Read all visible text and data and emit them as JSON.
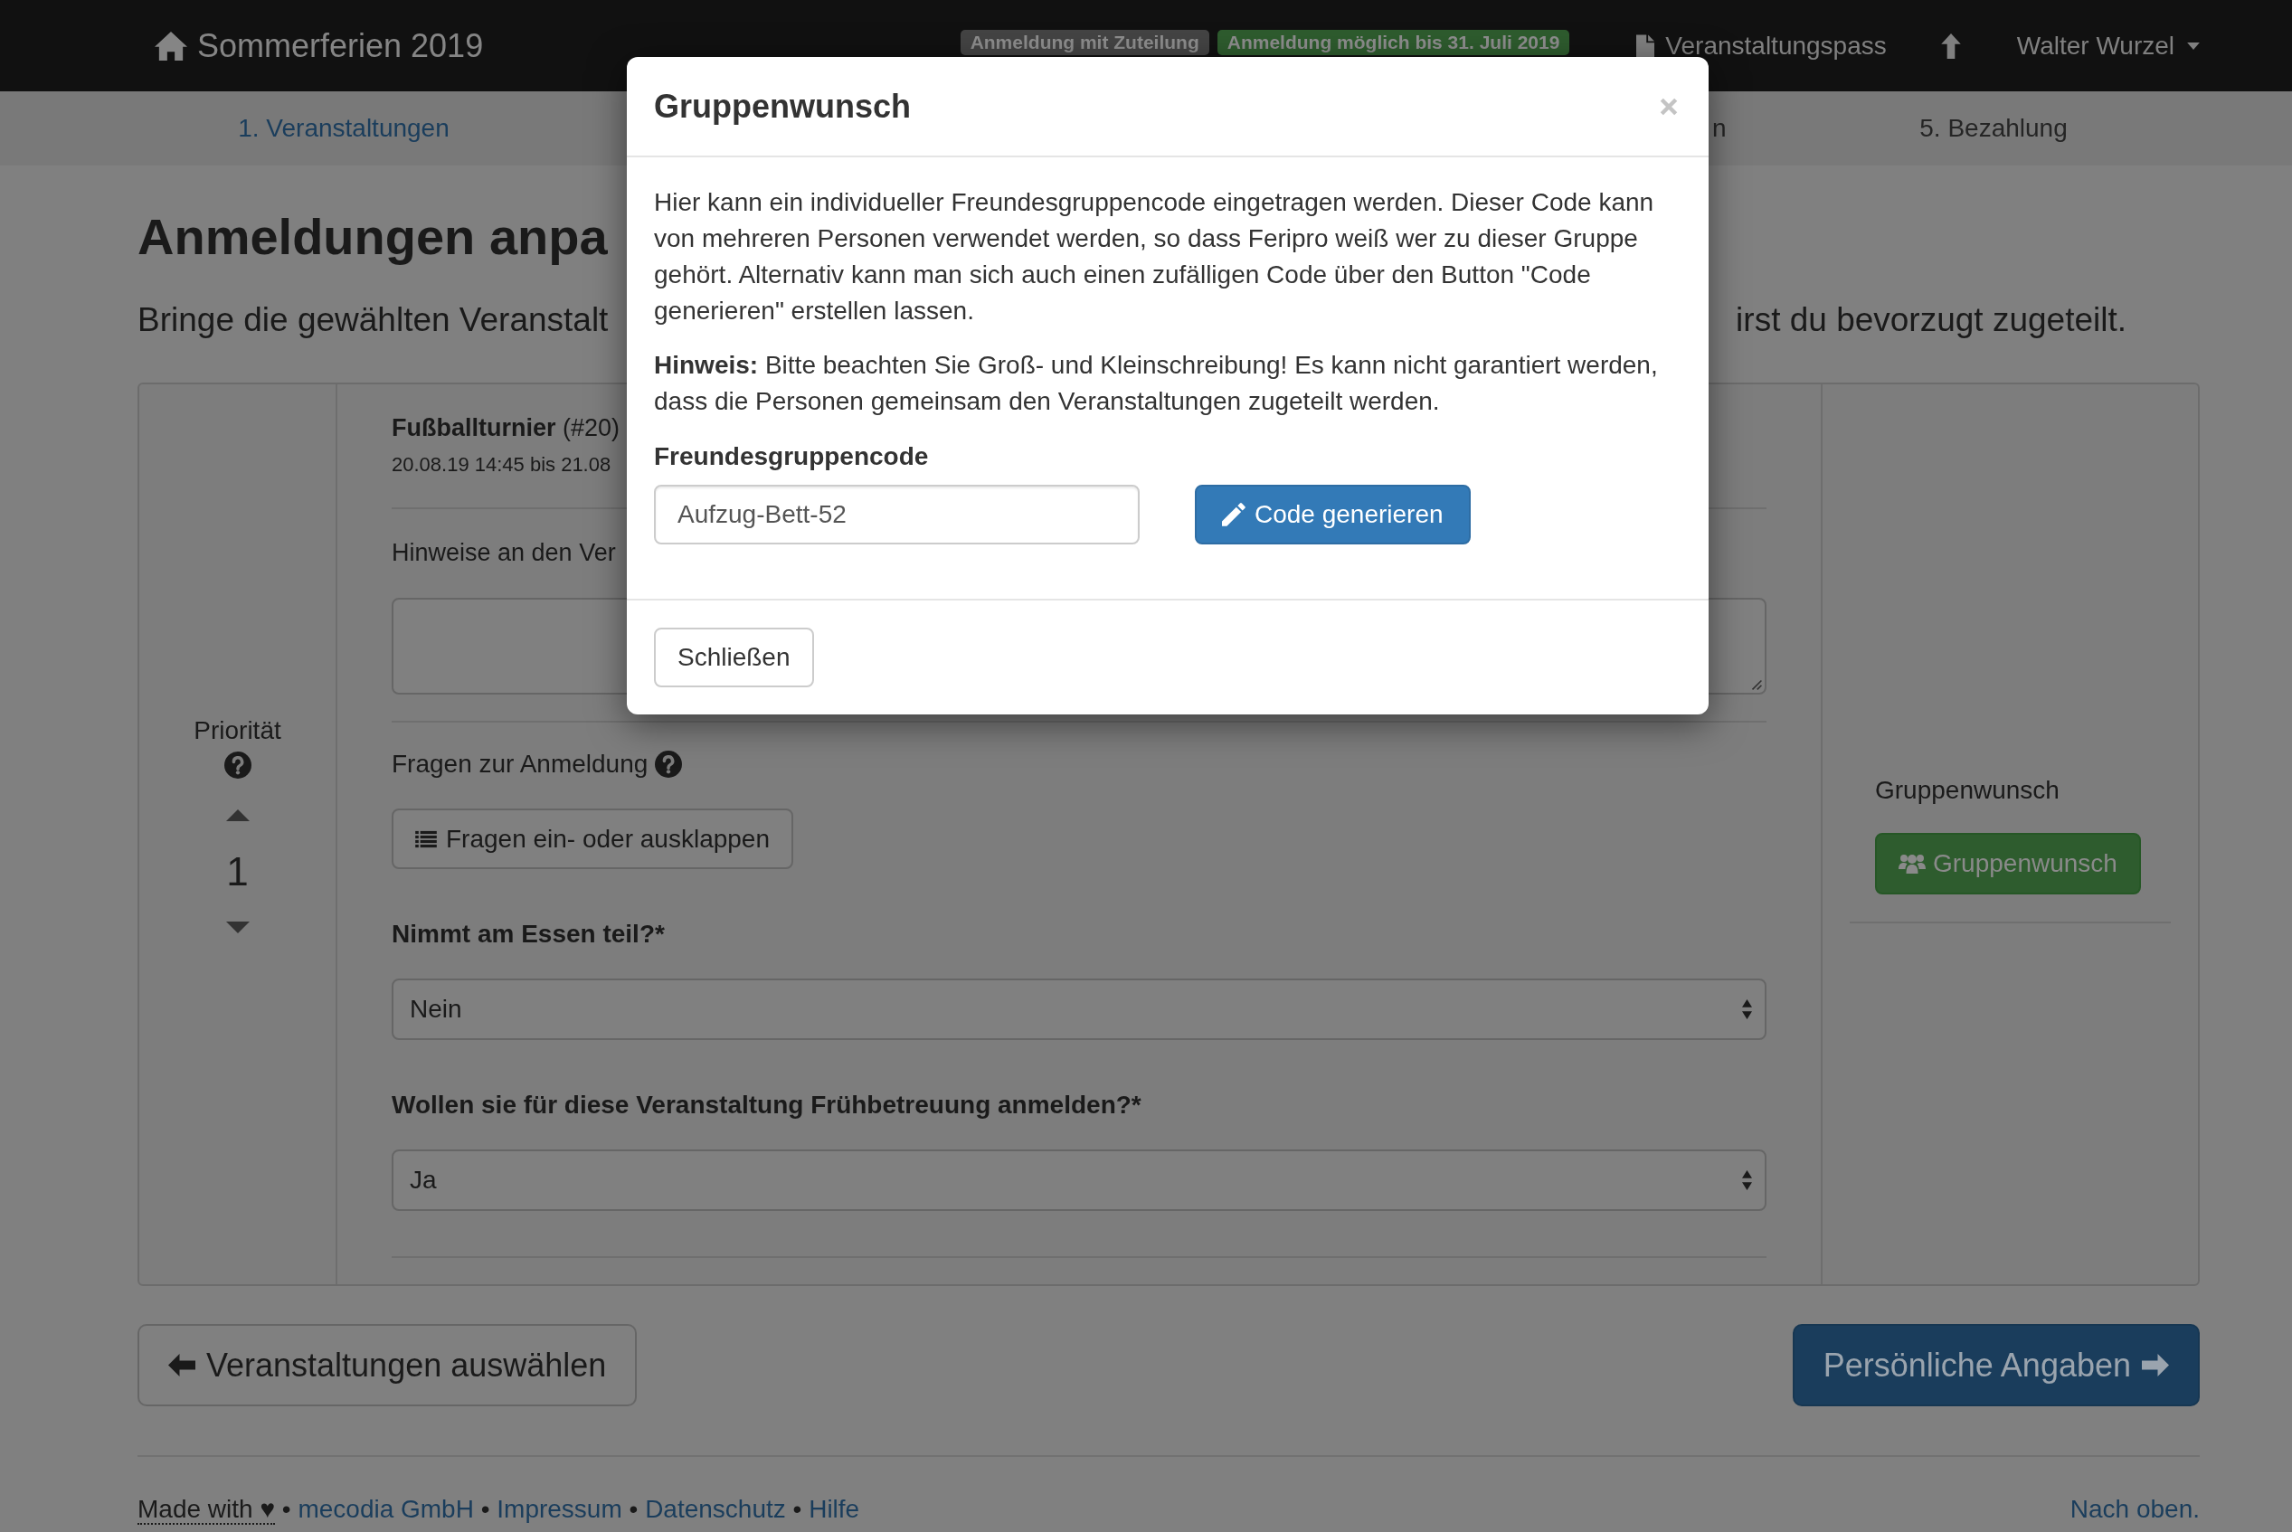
{
  "navbar": {
    "brand": "Sommerferien 2019",
    "badges": [
      {
        "text": "Anmeldung mit Zuteilung",
        "color": "#444444"
      },
      {
        "text": "Anmeldung möglich bis 31. Juli 2019",
        "color": "#2e5c2e"
      }
    ],
    "pass_link": "Veranstaltungspass",
    "user": "Walter Wurzel"
  },
  "steps": [
    {
      "label": "1. Veranstaltungen",
      "selected": true
    },
    {
      "label": "n",
      "selected": false
    },
    {
      "label": "5. Bezahlung",
      "selected": false
    }
  ],
  "page": {
    "title": "Anmeldungen anpa",
    "lead_parts": [
      "Bringe die gewählten Veranstalt",
      "irst du bevorzugt zugeteilt."
    ]
  },
  "registration": {
    "priority": {
      "label": "Priorität",
      "value": "1"
    },
    "event": {
      "title": "**Fußballturnier** (#20)",
      "dates": "20.08.19 14:45 bis 21.08"
    },
    "notes_label": "Hinweise an den Ver",
    "questions_label": "Fragen zur Anmeldung",
    "toggle_button": "Fragen ein- oder ausklappen",
    "questions": [
      {
        "label": "Nimmt am Essen teil?*",
        "value": "Nein"
      },
      {
        "label": "Wollen sie für diese Veranstaltung Frühbetreuung anmelden?*",
        "value": "Ja"
      }
    ],
    "group": {
      "label": "Gruppenwunsch",
      "button": "Gruppenwunsch"
    }
  },
  "actions": {
    "back": "Veranstaltungen auswählen",
    "next": "Persönliche Angaben"
  },
  "footer": {
    "items": [
      {
        "kind": "note",
        "text": "Made with ♥"
      },
      {
        "kind": "link",
        "separator": "•",
        "text": "mecodia GmbH"
      },
      {
        "kind": "link",
        "separator": "•",
        "text": "Impressum"
      },
      {
        "kind": "link",
        "separator": "•",
        "text": "Datenschutz"
      },
      {
        "kind": "link",
        "separator": "•",
        "text": "Hilfe"
      }
    ],
    "back_to_top": "Nach oben."
  },
  "modal": {
    "title": "Gruppenwunsch",
    "description": "Hier kann ein individueller Freundesgruppencode eingetragen werden. Dieser Code kann von mehreren Personen verwendet werden, so dass Feripro weiß wer zu dieser Gruppe gehört. Alternativ kann man sich auch einen zufälligen Code über den Button \"Code generieren\" erstellen lassen.",
    "hint": "**Hinweis:** Bitte beachten Sie Groß- und Kleinschreibung! Es kann nicht garantiert werden, dass die Personen gemeinsam den Veranstaltungen zugeteilt werden.",
    "field_label": "Freundesgruppencode",
    "field_value": "Aufzug-Bett-52",
    "generate_button": "Code generieren",
    "close_button": "Schließen"
  }
}
